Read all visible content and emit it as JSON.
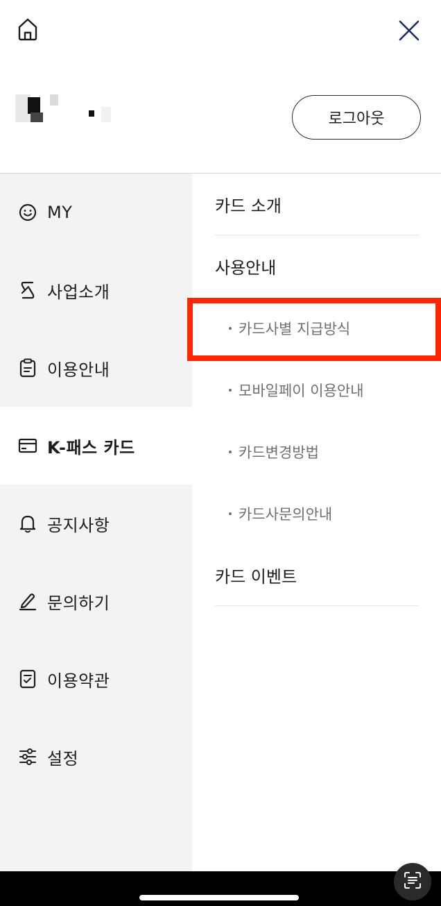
{
  "header": {
    "home_icon": "home-icon",
    "close_icon": "close-icon",
    "logout_label": "로그아웃"
  },
  "nav": {
    "items": [
      {
        "label": "MY",
        "icon": "smile-icon"
      },
      {
        "label": "사업소개",
        "icon": "brand-logo-icon"
      },
      {
        "label": "이용안내",
        "icon": "clipboard-icon"
      },
      {
        "label": "K-패스 카드",
        "icon": "card-icon"
      },
      {
        "label": "공지사항",
        "icon": "bell-icon"
      },
      {
        "label": "문의하기",
        "icon": "pencil-icon"
      },
      {
        "label": "이용약관",
        "icon": "checklist-icon"
      },
      {
        "label": "설정",
        "icon": "sliders-icon"
      }
    ],
    "active_label": "K-패스 카드"
  },
  "submenu": {
    "card_intro": "카드 소개",
    "usage_guide": "사용안내",
    "usage_items": [
      "카드사별 지급방식",
      "모바일페이 이용안내",
      "카드변경방법",
      "카드사문의안내"
    ],
    "card_event": "카드 이벤트"
  },
  "highlight_color": "#ff2600"
}
